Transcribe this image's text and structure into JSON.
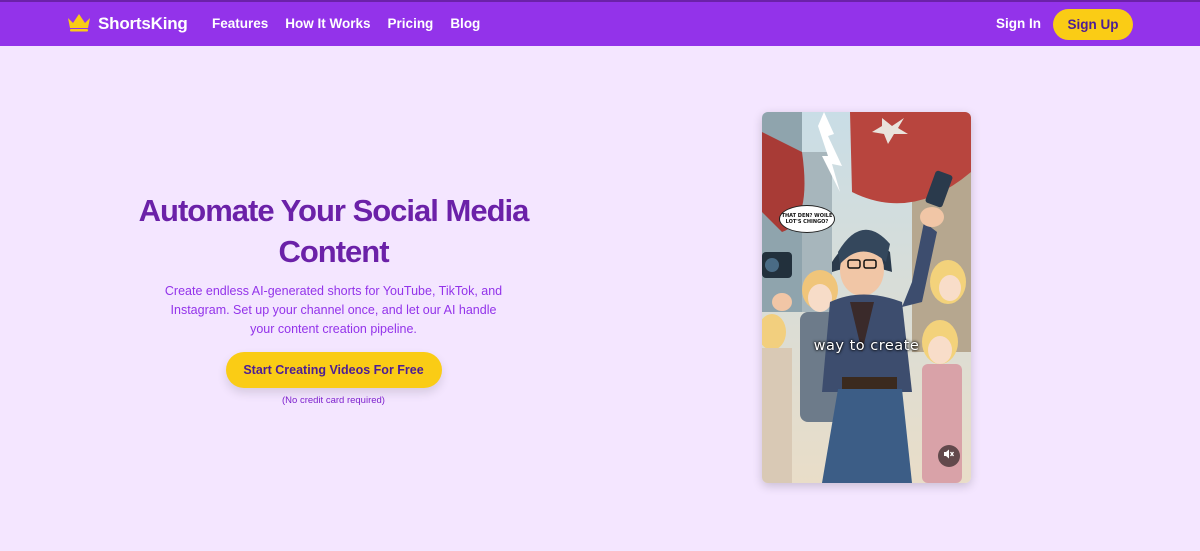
{
  "brand": {
    "name": "ShortsKing",
    "logo_icon": "crown-icon",
    "nav_color": "#9333ea",
    "accent": "#facc15",
    "title_color": "#6b21a8"
  },
  "nav": {
    "links": [
      {
        "label": "Features"
      },
      {
        "label": "How It Works"
      },
      {
        "label": "Pricing"
      },
      {
        "label": "Blog"
      }
    ],
    "sign_in": "Sign In",
    "sign_up": "Sign Up"
  },
  "hero": {
    "title_line1": "Automate Your Social Media",
    "title_line2": "Content",
    "subtitle": "Create endless AI-generated shorts for YouTube, TikTok, and Instagram. Set up your channel once, and let our AI handle your content creation pipeline.",
    "cta": "Start Creating Videos For Free",
    "cta_note": "(No credit card required)"
  },
  "video": {
    "caption": "way to create",
    "speech_bubble": "THAT DEN? WOILE LOT'S CHINGO?",
    "mute_icon": "mute-icon"
  }
}
